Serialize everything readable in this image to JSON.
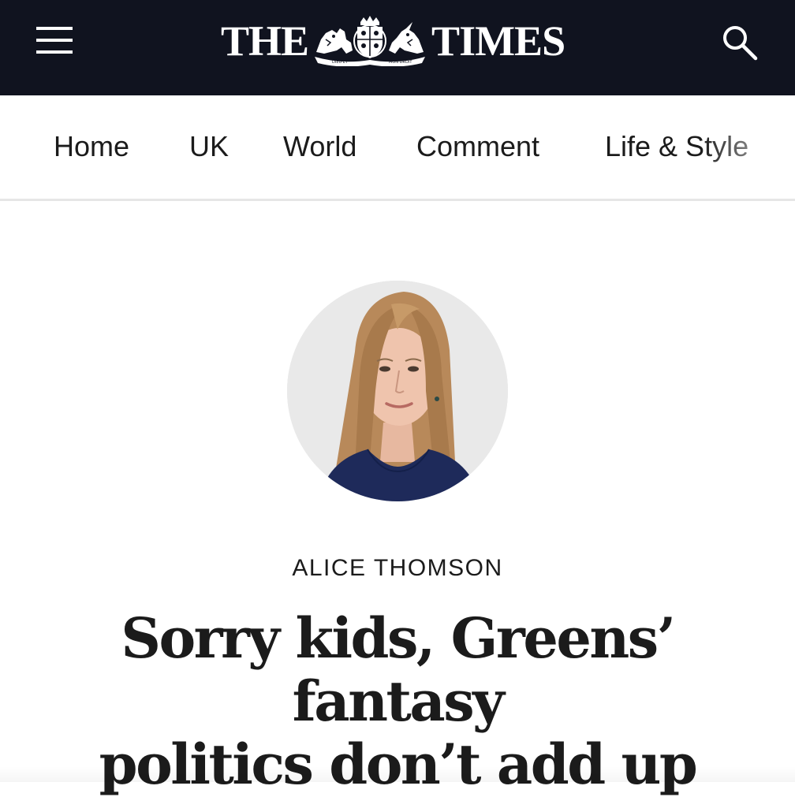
{
  "header": {
    "logo_left": "THE",
    "logo_right": "TIMES",
    "crest_motto_left": "DIEU ET",
    "crest_motto_right": "MON DROIT",
    "menu_icon": "hamburger-menu-icon",
    "search_icon": "magnifier-search-icon",
    "background": "#10131f"
  },
  "nav": {
    "items": [
      {
        "label": "Home"
      },
      {
        "label": "UK"
      },
      {
        "label": "World"
      },
      {
        "label": "Comment"
      },
      {
        "label": "Life & Style"
      }
    ]
  },
  "article": {
    "author": "ALICE THOMSON",
    "headline_line1": "Sorry kids, Greens’ fantasy",
    "headline_line2": "politics don’t add up"
  }
}
